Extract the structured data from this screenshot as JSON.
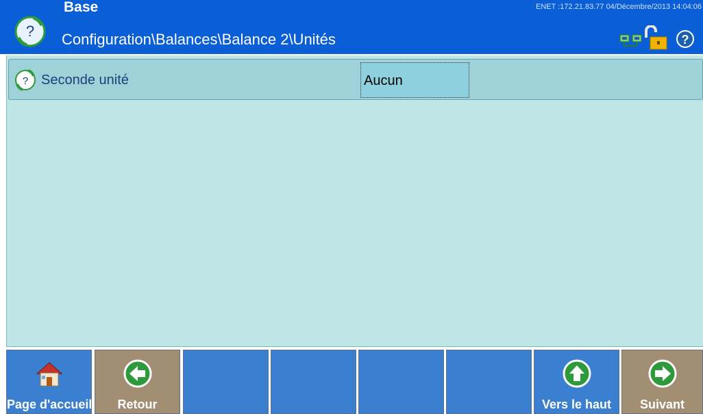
{
  "header": {
    "title": "Base",
    "path": "Configuration\\Balances\\Balance 2\\Unités",
    "status": "ENET :172.21.83.77  04/Décembre/2013 14:04:06",
    "icons": [
      "help-circle-icon",
      "network-icon",
      "unlocked-padlock-icon",
      "help-icon"
    ]
  },
  "main": {
    "row": {
      "label": "Seconde unité",
      "value": "Aucun",
      "icon": "help-circle-icon"
    }
  },
  "toolbar": {
    "buttons": [
      {
        "label": "Page d'accueil",
        "icon": "home-icon",
        "color": "#3a7fd0"
      },
      {
        "label": "Retour",
        "icon": "left-arrow-icon",
        "color": "#a28e72"
      },
      {
        "label": "",
        "icon": "",
        "color": "#3a7fd0"
      },
      {
        "label": "",
        "icon": "",
        "color": "#3a7fd0"
      },
      {
        "label": "",
        "icon": "",
        "color": "#3a7fd0"
      },
      {
        "label": "",
        "icon": "",
        "color": "#3a7fd0"
      },
      {
        "label": "Vers le haut",
        "icon": "up-arrow-icon",
        "color": "#3a7fd0"
      },
      {
        "label": "Suivant",
        "icon": "right-arrow-icon",
        "color": "#a28e72"
      }
    ]
  },
  "colors": {
    "header_bg": "#0a5fd6",
    "panel_bg": "#bfe6e6",
    "row_bg": "#9fd2d8",
    "value_bg": "#8fd0de",
    "toolbar_blue": "#3a7fd0",
    "toolbar_tan": "#a28e72"
  }
}
